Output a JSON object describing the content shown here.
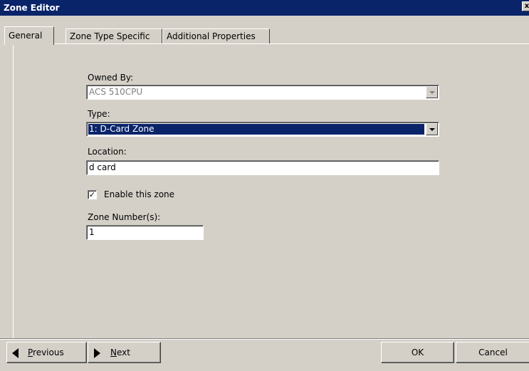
{
  "window": {
    "title": "Zone Editor",
    "close_glyph": "x"
  },
  "tabs": [
    {
      "label": "General",
      "active": true
    },
    {
      "label": "Zone Type Specific",
      "active": false
    },
    {
      "label": "Additional Properties",
      "active": false
    }
  ],
  "form": {
    "owned_by": {
      "label": "Owned By:",
      "value": "ACS 510CPU",
      "disabled": true
    },
    "type": {
      "label": "Type:",
      "value": "1: D-Card Zone",
      "selected": true
    },
    "location": {
      "label": "Location:",
      "value": "d card"
    },
    "enable": {
      "label": "Enable this zone",
      "checked": true,
      "check_glyph": "✓"
    },
    "zone_numbers": {
      "label": "Zone Number(s):",
      "value": "1"
    }
  },
  "buttons": {
    "previous": "Previous",
    "next": "Next",
    "ok": "OK",
    "cancel": "Cancel"
  },
  "icons": {
    "previous": "left-arrow-icon",
    "next": "right-arrow-icon",
    "dropdown": "chevron-down-icon"
  }
}
